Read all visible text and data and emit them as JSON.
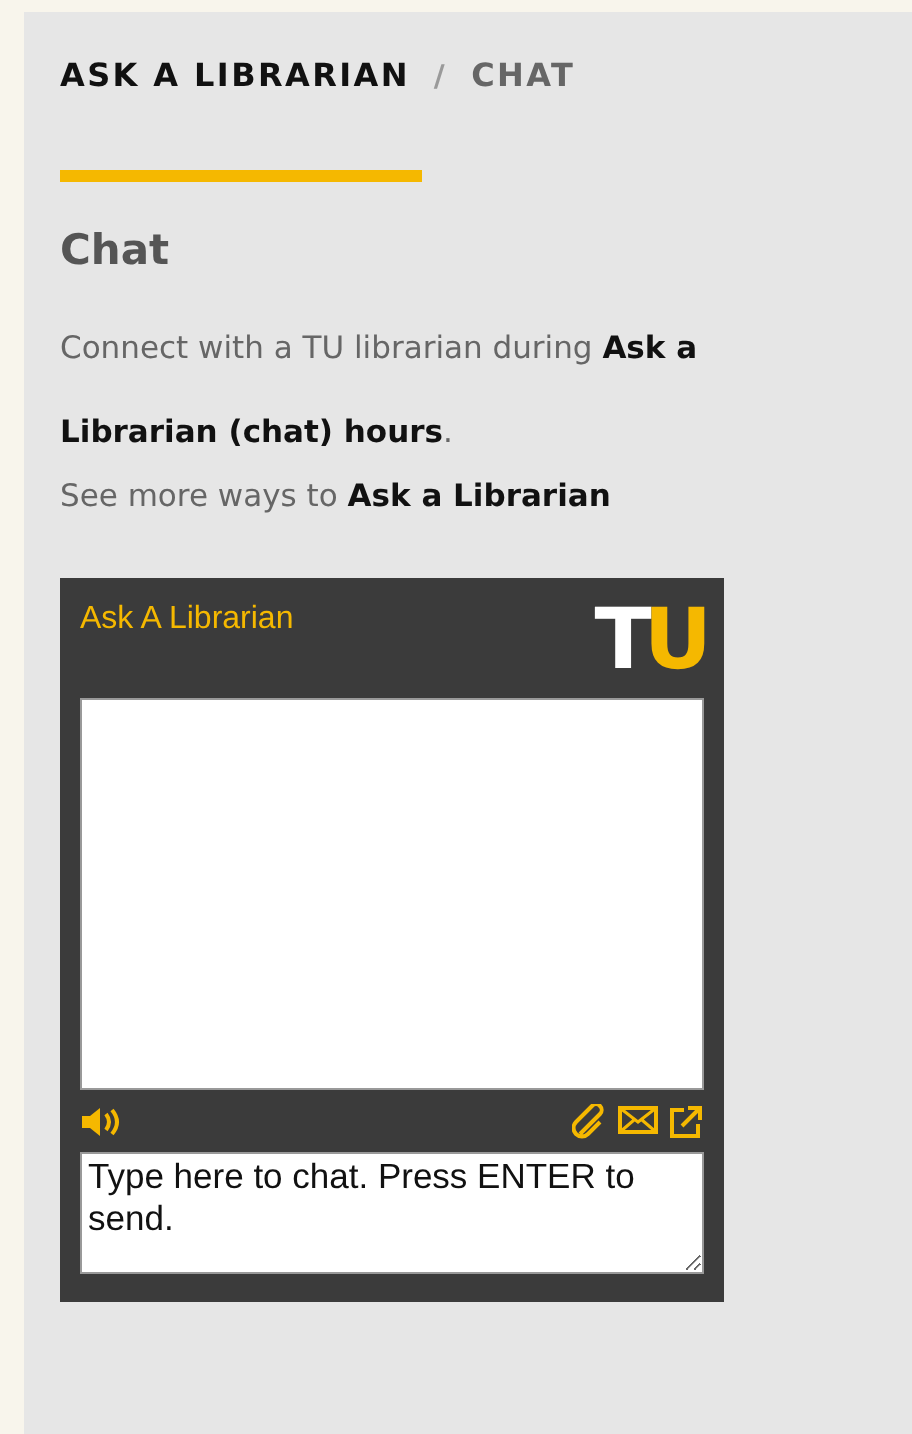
{
  "breadcrumb": [
    {
      "label": "ASK A LIBRARIAN",
      "current": false
    },
    {
      "label": "CHAT",
      "current": true
    }
  ],
  "breadcrumb_separator": "/",
  "heading": "Chat",
  "paragraphs": [
    "Connect with a TU librarian during **Ask a Librarian (chat) hours**.",
    "See more ways to **Ask a Librarian**"
  ],
  "chat_widget": {
    "title": "Ask A Librarian",
    "logo_letters": [
      {
        "letter": "T",
        "color": "#ffffff"
      },
      {
        "letter": "U",
        "color": "#f5b800"
      }
    ],
    "input": {
      "placeholder": "Type here to chat. Press ENTER to send."
    }
  }
}
